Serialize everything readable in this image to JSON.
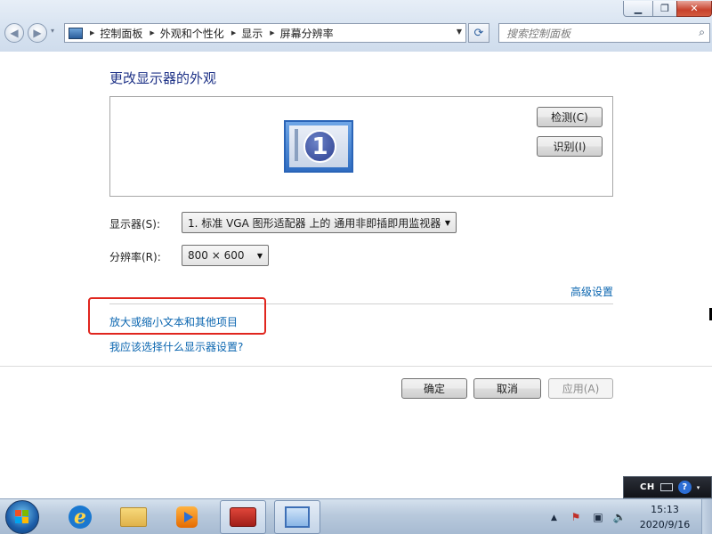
{
  "window": {
    "minimize_icon": "minimize-icon",
    "maximize_icon": "maximize-icon",
    "close_icon": "close-icon",
    "close_symbol": "✕",
    "minimize_symbol": "▁",
    "maximize_symbol": "❐"
  },
  "nav": {
    "back_symbol": "◀",
    "forward_symbol": "▶",
    "dropdown_symbol": "▾"
  },
  "address": {
    "breadcrumbs": [
      "控制面板",
      "外观和个性化",
      "显示",
      "屏幕分辨率"
    ],
    "separator": "▶",
    "dropdown_symbol": "▼",
    "refresh_symbol": "⟳"
  },
  "search": {
    "placeholder": "搜索控制面板",
    "icon_symbol": "⌕"
  },
  "main": {
    "title": "更改显示器的外观",
    "monitor_number": "1",
    "detect_label": "检测(C)",
    "identify_label": "识别(I)",
    "display_label": "显示器(S):",
    "display_value": "1. 标准 VGA 图形适配器 上的 通用非即插即用监视器",
    "resolution_label": "分辨率(R):",
    "resolution_value": "800 × 600",
    "advanced_link": "高级设置",
    "scale_link": "放大或缩小文本和其他项目",
    "which_link": "我应该选择什么显示器设置?",
    "ok_label": "确定",
    "cancel_label": "取消",
    "apply_label": "应用(A)"
  },
  "colors": {
    "title_blue": "#1e3287",
    "link_blue": "#0b66b0",
    "highlight_red": "#e0261e"
  },
  "langbar": {
    "language": "CH",
    "help_symbol": "?",
    "options_symbol": "▾"
  },
  "taskbar": {
    "apps": [
      "internet-explorer-icon",
      "windows-explorer-icon",
      "media-center-icon",
      "toolbox-icon",
      "control-panel-icon"
    ],
    "tray_expand_symbol": "▲",
    "flag_symbol": "⚑",
    "network_symbol": "▣",
    "volume_symbol": "🔈",
    "time": "15:13",
    "date": "2020/9/16"
  }
}
